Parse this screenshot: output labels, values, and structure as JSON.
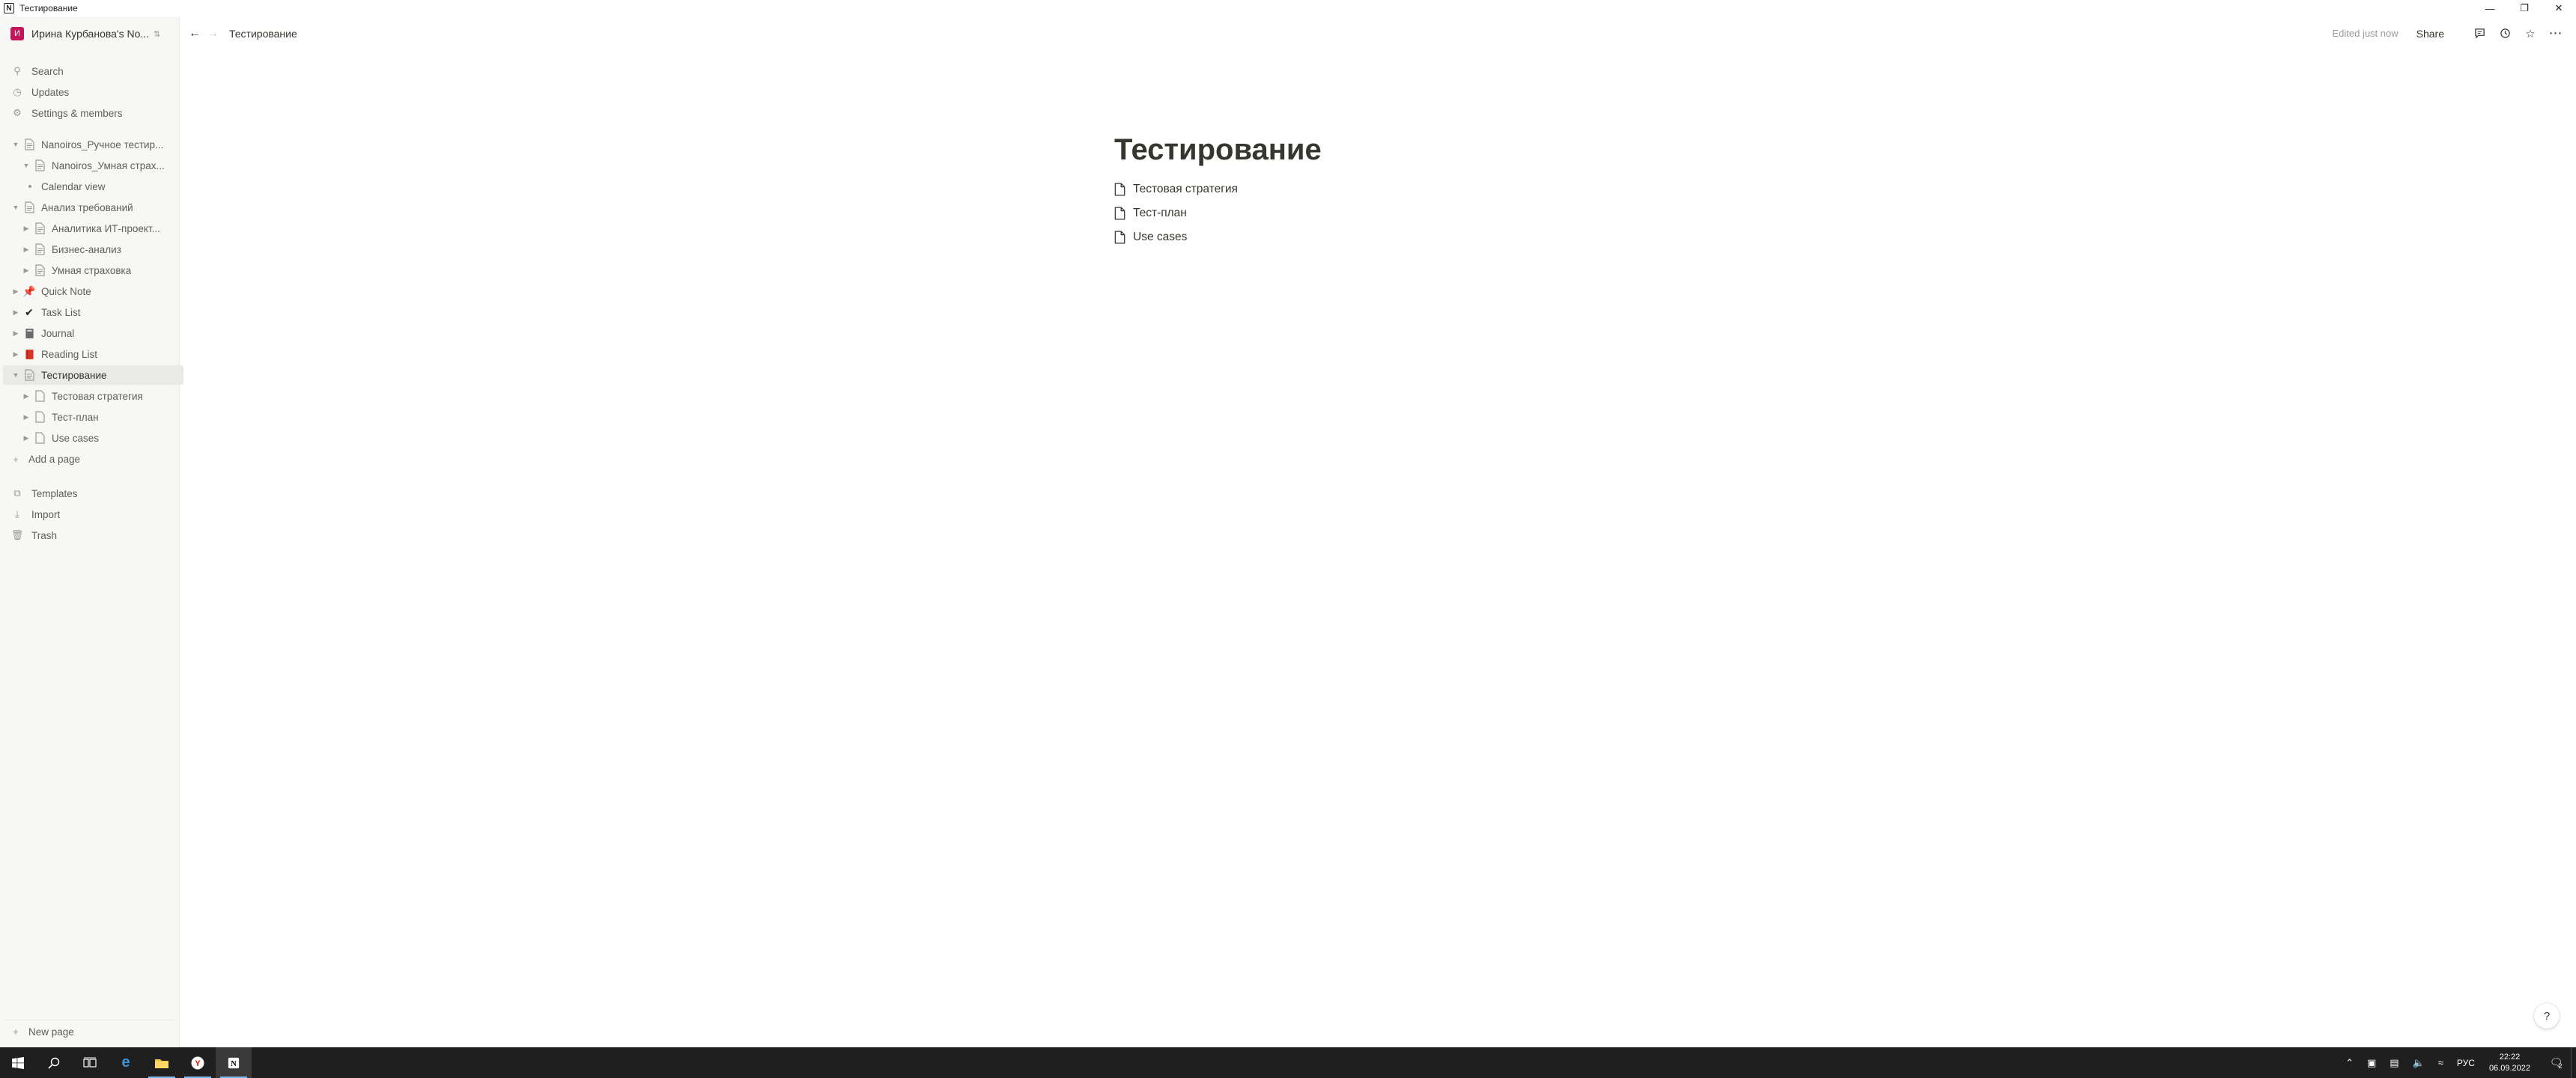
{
  "window": {
    "title": "Тестирование",
    "app_icon": "N",
    "controls": [
      "minimize",
      "restore",
      "close"
    ]
  },
  "sidebar": {
    "workspace_initial": "И",
    "workspace_name": "Ирина Курбанова's No...",
    "top_items": [
      {
        "label": "Search",
        "icon": "search-icon"
      },
      {
        "label": "Updates",
        "icon": "clock-icon"
      },
      {
        "label": "Settings & members",
        "icon": "gear-icon"
      }
    ],
    "tree": [
      {
        "label": "Nanoiros_Ручное тестир...",
        "icon": "page-icon",
        "expanded": true
      },
      {
        "label": "Nanoiros_Умная страх...",
        "icon": "page-icon",
        "expanded": true
      },
      {
        "label": "Calendar view",
        "icon": "bullet"
      },
      {
        "label": "Анализ требований",
        "icon": "page-icon",
        "expanded": true
      },
      {
        "label": "Аналитика ИТ-проект...",
        "icon": "page-icon",
        "expanded": false
      },
      {
        "label": "Бизнес-анализ",
        "icon": "page-icon",
        "expanded": false
      },
      {
        "label": "Умная страховка",
        "icon": "page-icon",
        "expanded": false
      },
      {
        "label": "Quick Note",
        "icon": "pushpin-icon",
        "expanded": false
      },
      {
        "label": "Task List",
        "icon": "checkmark-icon",
        "expanded": false
      },
      {
        "label": "Journal",
        "icon": "notebook-icon",
        "expanded": false
      },
      {
        "label": "Reading List",
        "icon": "book-icon",
        "expanded": false
      },
      {
        "label": "Тестирование",
        "icon": "page-icon",
        "expanded": true,
        "active": true
      },
      {
        "label": "Тестовая стратегия",
        "icon": "page-icon",
        "expanded": false
      },
      {
        "label": "Тест-план",
        "icon": "page-icon",
        "expanded": false
      },
      {
        "label": "Use cases",
        "icon": "page-icon",
        "expanded": false
      }
    ],
    "add_page": "Add a page",
    "bottom_items": [
      {
        "label": "Templates",
        "icon": "templates-icon"
      },
      {
        "label": "Import",
        "icon": "import-icon"
      },
      {
        "label": "Trash",
        "icon": "trash-icon"
      }
    ],
    "new_page": "New page"
  },
  "topbar": {
    "breadcrumb": "Тестирование",
    "edited": "Edited just now",
    "share": "Share"
  },
  "main": {
    "title": "Тестирование",
    "children": [
      "Тестовая стратегия",
      "Тест-план",
      "Use cases"
    ],
    "help": "?"
  },
  "taskbar": {
    "language": "РУС",
    "time": "22:22",
    "date": "06.09.2022",
    "notification_count": "2"
  },
  "colors": {
    "sidebar_bg": "#f7f7f5",
    "text": "#37352f",
    "muted": "#9b9a97",
    "taskbar": "#1f1f1f",
    "workspace_avatar": "#c2185b"
  }
}
